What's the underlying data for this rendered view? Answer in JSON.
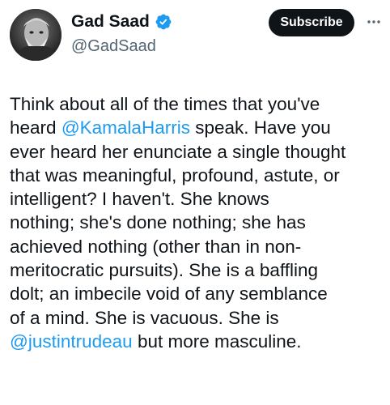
{
  "author": {
    "display_name": "Gad Saad",
    "handle": "@GadSaad",
    "verified_icon": "verified-badge-icon",
    "avatar_icon": "profile-avatar"
  },
  "header": {
    "subscribe_label": "Subscribe",
    "more_icon": "more-options-icon"
  },
  "tweet": {
    "lines": [
      [
        {
          "text": "Think about all of the times that you've"
        }
      ],
      [
        {
          "text": "heard "
        },
        {
          "text": "@KamalaHarris",
          "mention": true
        },
        {
          "text": " speak.  Have you"
        }
      ],
      [
        {
          "text": "ever heard her enunciate a single thought"
        }
      ],
      [
        {
          "text": "that was meaningful, profound, astute, or"
        }
      ],
      [
        {
          "text": "intelligent?  I haven't.  She knows"
        }
      ],
      [
        {
          "text": "nothing; she's done nothing; she has"
        }
      ],
      [
        {
          "text": "achieved nothing (other than in non-"
        }
      ],
      [
        {
          "text": "meritocratic pursuits). She is a baffling"
        }
      ],
      [
        {
          "text": "dolt; an imbecile void of any semblance"
        }
      ],
      [
        {
          "text": "of a mind.  She is vacuous.  She is"
        }
      ],
      [
        {
          "text": "@justintrudeau",
          "mention": true
        },
        {
          "text": " but more masculine."
        }
      ]
    ]
  },
  "colors": {
    "text": "#0f1419",
    "secondary": "#536471",
    "mention": "#1d9bf0",
    "verified": "#1d9bf0",
    "button_bg": "#0f1419"
  }
}
